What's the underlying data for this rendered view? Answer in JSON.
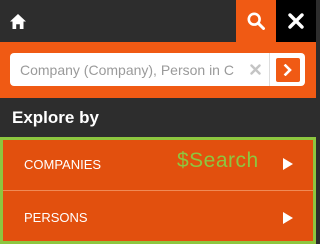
{
  "topbar": {
    "home_icon": "home-icon",
    "search_icon": "search-icon",
    "close_icon": "close-icon"
  },
  "search": {
    "placeholder": "Company (Company), Person in C",
    "value": "",
    "clear_icon": "clear-icon",
    "go_icon": "chevron-right-icon"
  },
  "explore": {
    "title": "Explore by",
    "items": [
      {
        "label": "COMPANIES",
        "icon": "play-arrow-icon"
      },
      {
        "label": "PERSONS",
        "icon": "play-arrow-icon"
      }
    ],
    "overlay_text": "$Search"
  },
  "colors": {
    "accent": "#f05a14",
    "list_bg": "#e2500e",
    "highlight": "#8dc63f",
    "background": "#2d2d2d"
  }
}
